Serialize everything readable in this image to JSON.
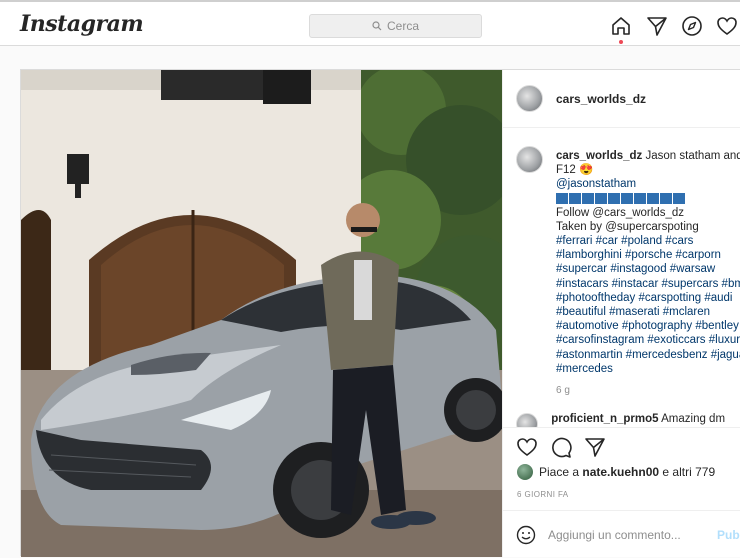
{
  "topbar": {
    "logo": "Instagram",
    "search_placeholder": "Cerca",
    "icons": [
      "home-icon",
      "direct-icon",
      "explore-icon",
      "activity-icon"
    ]
  },
  "post": {
    "username": "cars_worlds_dz",
    "caption_lines": [
      "Jason statham and his",
      "F12"
    ],
    "mention": "@jasonstatham",
    "flag_count": 10,
    "follow_line": "Follow @cars_worlds_dz",
    "taken_line": "Taken by @supercarspoting",
    "hashtag_lines": [
      "#ferrari #car #poland #cars",
      "#lamborghini #porsche #carporn",
      "#supercar #instagood #warsaw",
      "#instacars #instacar #supercars #bmw",
      "#photooftheday #carspotting #audi",
      "#beautiful #maserati #mclaren",
      "#automotive #photography #bentley",
      "#carsofinstagram #exoticcars #luxury",
      "#astonmartin #mercedesbenz #jaguar",
      "#mercedes"
    ],
    "caption_time": "6 g",
    "comment_user": "proficient_n_prmo5",
    "comment_text": "Amazing dm",
    "likes_prefix": "Piace a",
    "likes_user": "nate.kuehn00",
    "likes_suffix": "e altri 779",
    "posted_ago": "6 GIORNI FA",
    "add_comment_placeholder": "Aggiungi un commento...",
    "publish_label": "Pubblica"
  },
  "colors": {
    "link": "#00376b",
    "muted": "#8e8e8e",
    "notification": "#ed4956",
    "publish": "#b2dffc"
  }
}
